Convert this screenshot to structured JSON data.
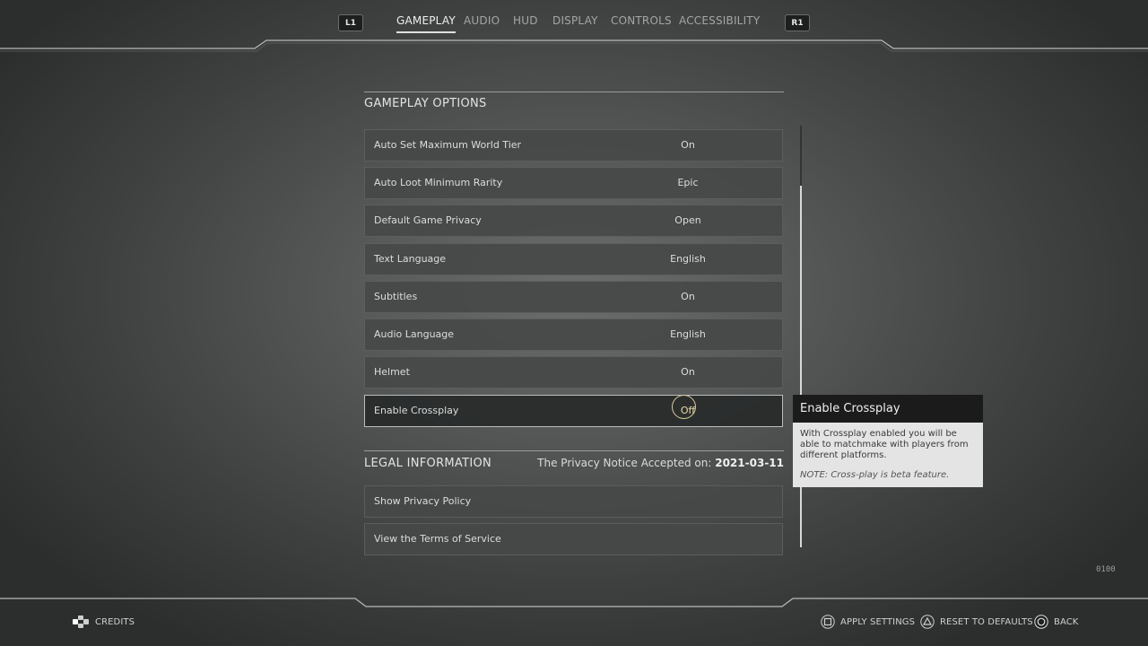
{
  "nav": {
    "left_bumper": "L1",
    "right_bumper": "R1",
    "tabs": [
      {
        "label": "GAMEPLAY",
        "active": true
      },
      {
        "label": "AUDIO",
        "active": false
      },
      {
        "label": "HUD",
        "active": false
      },
      {
        "label": "DISPLAY",
        "active": false
      },
      {
        "label": "CONTROLS",
        "active": false
      },
      {
        "label": "ACCESSIBILITY",
        "active": false
      }
    ]
  },
  "gameplay": {
    "title": "GAMEPLAY OPTIONS",
    "options": [
      {
        "label": "Auto Set Maximum World Tier",
        "value": "On"
      },
      {
        "label": "Auto Loot Minimum Rarity",
        "value": "Epic"
      },
      {
        "label": "Default Game Privacy",
        "value": "Open"
      },
      {
        "label": "Text Language",
        "value": "English"
      },
      {
        "label": "Subtitles",
        "value": "On"
      },
      {
        "label": "Audio Language",
        "value": "English"
      },
      {
        "label": "Helmet",
        "value": "On"
      },
      {
        "label": "Enable Crossplay",
        "value": "Off",
        "selected": true
      }
    ]
  },
  "legal": {
    "title": "LEGAL INFORMATION",
    "notice_prefix": "The Privacy Notice Accepted on:",
    "notice_date": "2021-03-11",
    "items": [
      {
        "label": "Show Privacy Policy"
      },
      {
        "label": "View the Terms of Service"
      }
    ]
  },
  "tooltip": {
    "title": "Enable Crossplay",
    "body": "With Crossplay enabled you will be able to matchmake with players from different platforms.",
    "note": "NOTE: Cross-play is beta feature."
  },
  "version": "0100",
  "bottom": {
    "credits": "CREDITS",
    "apply": "APPLY SETTINGS",
    "reset": "RESET TO DEFAULTS",
    "back": "BACK"
  },
  "colors": {
    "accent_cursor": "#d9cc9b",
    "tooltip_header": "#1b1b1b",
    "tooltip_body": "#e4e4e4"
  },
  "icons": {
    "credits": "dpad-icon",
    "apply": "square-button-icon",
    "reset": "triangle-button-icon",
    "back": "circle-button-icon"
  }
}
